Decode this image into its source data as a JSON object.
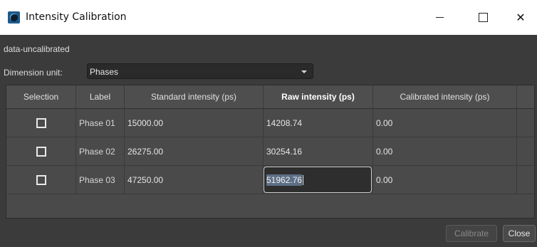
{
  "window": {
    "title": "Intensity Calibration",
    "controls": {
      "minimize": "—",
      "maximize": "☐",
      "close": "✕"
    }
  },
  "dataset_name": "data-uncalibrated",
  "dimension": {
    "label": "Dimension unit:",
    "selected": "Phases"
  },
  "table": {
    "columns": [
      "Selection",
      "Label",
      "Standard intensity (ps)",
      "Raw intensity (ps)",
      "Calibrated intensity (ps)"
    ],
    "rows": [
      {
        "selected": false,
        "label": "Phase 01",
        "standard": "15000.00",
        "raw": "14208.74",
        "calibrated": "0.00"
      },
      {
        "selected": false,
        "label": "Phase 02",
        "standard": "26275.00",
        "raw": "30254.16",
        "calibrated": "0.00"
      },
      {
        "selected": false,
        "label": "Phase 03",
        "standard": "47250.00",
        "raw": "51962.76",
        "calibrated": "0.00"
      }
    ]
  },
  "buttons": {
    "calibrate": "Calibrate",
    "close": "Close"
  },
  "colors": {
    "background": "#3b3b3b",
    "table": "#4a4a4a",
    "edit_highlight": "#5d6f86"
  }
}
